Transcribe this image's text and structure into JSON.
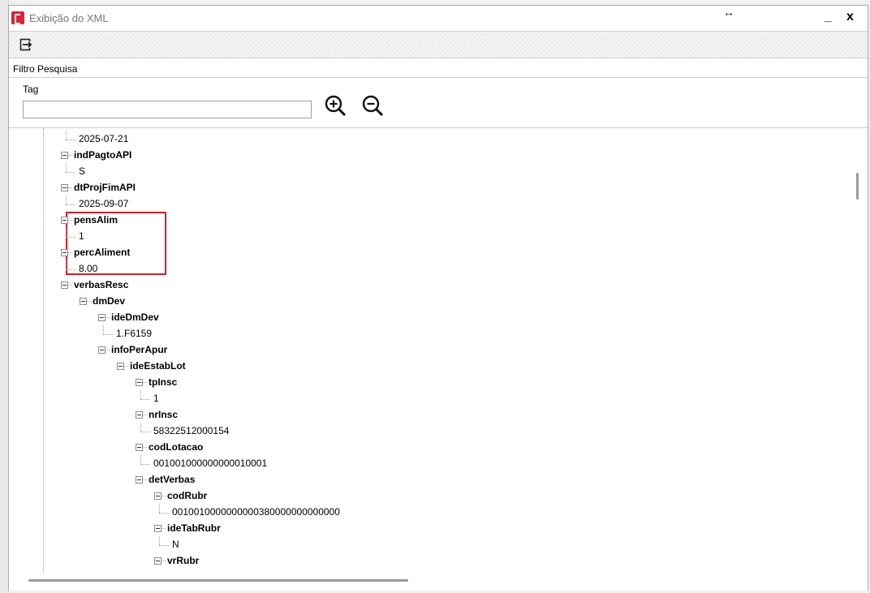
{
  "window": {
    "title": "Exibição do XML",
    "resize_glyph": "↔",
    "minimize_glyph": "_",
    "close_glyph": "x"
  },
  "toolbar": {
    "exit_icon": "exit-icon"
  },
  "filter": {
    "header": "Filtro Pesquisa",
    "tag_label": "Tag",
    "tag_value": "",
    "zoom_in_icon": "zoom-in-icon",
    "zoom_out_icon": "zoom-out-icon"
  },
  "tree": {
    "highlight_color": "#d0202a",
    "rows": [
      {
        "text": "2025-07-21",
        "kind": "value",
        "depth": 3
      },
      {
        "text": "indPagtoAPI",
        "kind": "node",
        "depth": 2
      },
      {
        "text": "S",
        "kind": "value",
        "depth": 3
      },
      {
        "text": "dtProjFimAPI",
        "kind": "node",
        "depth": 2
      },
      {
        "text": "2025-09-07",
        "kind": "value",
        "depth": 3
      },
      {
        "text": "pensAlim",
        "kind": "node",
        "depth": 2
      },
      {
        "text": "1",
        "kind": "value",
        "depth": 3
      },
      {
        "text": "percAliment",
        "kind": "node",
        "depth": 2
      },
      {
        "text": "8.00",
        "kind": "value",
        "depth": 3
      },
      {
        "text": "verbasResc",
        "kind": "node",
        "depth": 2
      },
      {
        "text": "dmDev",
        "kind": "node",
        "depth": 3
      },
      {
        "text": "ideDmDev",
        "kind": "node",
        "depth": 4
      },
      {
        "text": "1.F6159",
        "kind": "value",
        "depth": 5
      },
      {
        "text": "infoPerApur",
        "kind": "node",
        "depth": 4
      },
      {
        "text": "ideEstabLot",
        "kind": "node",
        "depth": 5
      },
      {
        "text": "tpInsc",
        "kind": "node",
        "depth": 6
      },
      {
        "text": "1",
        "kind": "value",
        "depth": 7
      },
      {
        "text": "nrInsc",
        "kind": "node",
        "depth": 6
      },
      {
        "text": "58322512000154",
        "kind": "value",
        "depth": 7
      },
      {
        "text": "codLotacao",
        "kind": "node",
        "depth": 6
      },
      {
        "text": "001001000000000010001",
        "kind": "value",
        "depth": 7
      },
      {
        "text": "detVerbas",
        "kind": "node",
        "depth": 6
      },
      {
        "text": "codRubr",
        "kind": "node",
        "depth": 7
      },
      {
        "text": "0010010000000000380000000000000",
        "kind": "value",
        "depth": 8
      },
      {
        "text": "ideTabRubr",
        "kind": "node",
        "depth": 7
      },
      {
        "text": "N",
        "kind": "value",
        "depth": 8
      },
      {
        "text": "vrRubr",
        "kind": "node",
        "depth": 7
      }
    ]
  }
}
